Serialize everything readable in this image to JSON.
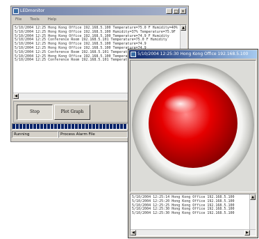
{
  "window1": {
    "title": "LEDmonitor",
    "menu": [
      "File",
      "Tools",
      "Help"
    ],
    "minimize": "_",
    "maximize": "□",
    "close": "×",
    "log_lines": [
      "5/10/2004 12:25 Hong Kong Office 192.168.5.100 Temperature=75.0 F Humidity=40%",
      "5/10/2004 12:25 Hong Kong Office 192.168.5.100 Humidity=37% Temperature=75.9F",
      "5/10/2004 12:25 Hong Kong Office 192.168.5.100 Temperature=74.9 F Humidity",
      "5/10/2004 12:25 Conference Room 192.168.5.101 Temperature=75.0 F Humidity",
      "5/10/2004 12:25 Hong Kong Office 192.168.5.100 Temperature=74.9",
      "5/10/2004 12:25 Hong Kong Office 192.168.5.100 Temperature=74.9",
      "5/10/2004 12:25 Conference Room 192.168.5.101 Temperature=75.0",
      "5/10/2004 12:25 Hong Kong Office 192.168.5.100 Temperature=74.9",
      "5/10/2004 12:25 Conference Room 192.168.5.101 Temperature=75.0"
    ],
    "stop_label": "Stop",
    "plot_label": "Plot Graph",
    "progress_fraction": 1.0,
    "status": [
      "Running",
      "Process Alarm File"
    ]
  },
  "window2": {
    "title": "5/10/2004 12:25:30 Hong Kong Office 192.168.5.100",
    "minimize": "_",
    "maximize": "□",
    "close": "×",
    "led_color": "#e60000",
    "log_lines": [
      "5/10/2004 12:25:14 Hong Kong Office 192.168.5.100",
      "5/10/2004 12:25:20 Hong Kong Office 192.168.5.100",
      "5/10/2004 12:25:25 Hong Kong Office 192.168.5.100",
      "5/10/2004 12:25:30 Hong Kong Office 192.168.5.100",
      "5/10/2004 12:25:30 Hong Kong Office 192.168.5.100"
    ]
  }
}
